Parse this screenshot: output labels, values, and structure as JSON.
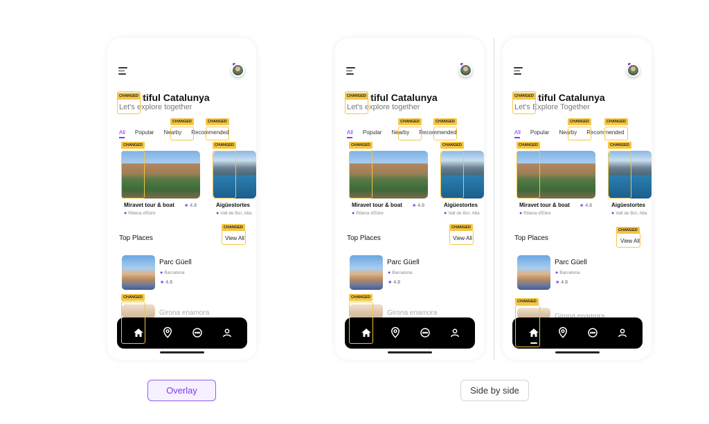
{
  "app": {
    "menu_icon": "menu-icon",
    "avatar_icon": "user-avatar",
    "title": "Beautiful Catalunya",
    "subtitle": "Let's explore together",
    "subtitle_changed": "Let's Explore Together",
    "tabs": [
      "All",
      "Popular",
      "Nearby",
      "Recommended"
    ],
    "cards": [
      {
        "title": "Miravet tour & boat",
        "location": "Ribera d'Ebre",
        "rating": "4.8"
      },
      {
        "title": "Aigüestortes",
        "location": "Vall de Boí, Alta"
      }
    ],
    "top_places_title": "Top Places",
    "view_all": "View All",
    "places": [
      {
        "name": "Parc Güell",
        "location": "Barcelona",
        "rating": "4.8"
      },
      {
        "name": "Girona enamora"
      }
    ],
    "nav": [
      "home-icon",
      "map-pin-icon",
      "chat-icon",
      "profile-icon"
    ]
  },
  "changed_tag": "CHANGED",
  "controls": {
    "overlay_label": "Overlay",
    "side_by_side_label": "Side by side"
  },
  "colors": {
    "accent": "#7c3aed",
    "changed": "#f5c542",
    "navbar": "#000000"
  }
}
